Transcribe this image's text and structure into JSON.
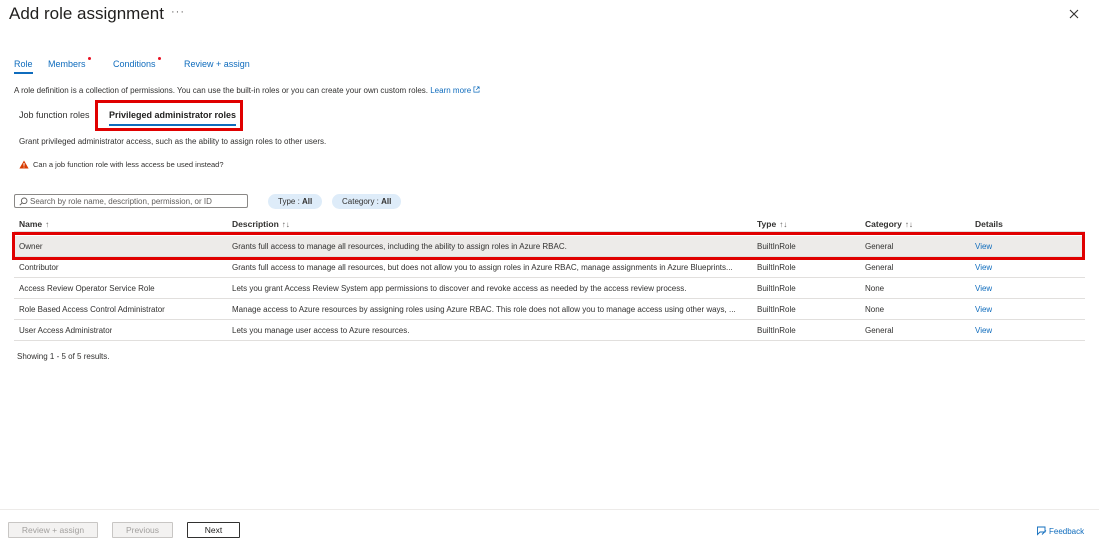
{
  "header": {
    "title": "Add role assignment",
    "more": "···"
  },
  "tabs": [
    {
      "label": "Role",
      "active": true,
      "dot": false
    },
    {
      "label": "Members",
      "active": false,
      "dot": true
    },
    {
      "label": "Conditions",
      "active": false,
      "dot": true
    },
    {
      "label": "Review + assign",
      "active": false,
      "dot": false
    }
  ],
  "description": {
    "text": "A role definition is a collection of permissions. You can use the built-in roles or you can create your own custom roles.",
    "learn_more": "Learn more"
  },
  "subtabs": {
    "job_function": "Job function roles",
    "privileged": "Privileged administrator roles"
  },
  "privileged_description": "Grant privileged administrator access, such as the ability to assign roles to other users.",
  "warning": "Can a job function role with less access be used instead?",
  "search": {
    "placeholder": "Search by role name, description, permission, or ID"
  },
  "filters": {
    "type": {
      "label": "Type : ",
      "value": "All"
    },
    "category": {
      "label": "Category : ",
      "value": "All"
    }
  },
  "table": {
    "columns": {
      "name": "Name",
      "description": "Description",
      "type": "Type",
      "category": "Category",
      "details": "Details"
    },
    "sort_name": "↑",
    "sort_other": "↑↓",
    "rows": [
      {
        "name": "Owner",
        "description": "Grants full access to manage all resources, including the ability to assign roles in Azure RBAC.",
        "type": "BuiltInRole",
        "category": "General",
        "details": "View"
      },
      {
        "name": "Contributor",
        "description": "Grants full access to manage all resources, but does not allow you to assign roles in Azure RBAC, manage assignments in Azure Blueprints...",
        "type": "BuiltInRole",
        "category": "General",
        "details": "View"
      },
      {
        "name": "Access Review Operator Service Role",
        "description": "Lets you grant Access Review System app permissions to discover and revoke access as needed by the access review process.",
        "type": "BuiltInRole",
        "category": "None",
        "details": "View"
      },
      {
        "name": "Role Based Access Control Administrator",
        "description": "Manage access to Azure resources by assigning roles using Azure RBAC. This role does not allow you to manage access using other ways, ...",
        "type": "BuiltInRole",
        "category": "None",
        "details": "View"
      },
      {
        "name": "User Access Administrator",
        "description": "Lets you manage user access to Azure resources.",
        "type": "BuiltInRole",
        "category": "General",
        "details": "View"
      }
    ]
  },
  "showing": "Showing 1 - 5 of 5 results.",
  "footer": {
    "review_assign": "Review + assign",
    "previous": "Previous",
    "next": "Next",
    "feedback": "Feedback"
  },
  "colors": {
    "accent": "#0f6cbd",
    "highlight": "#e00000",
    "warning": "#d83b01",
    "pill_bg": "#deecf9"
  }
}
